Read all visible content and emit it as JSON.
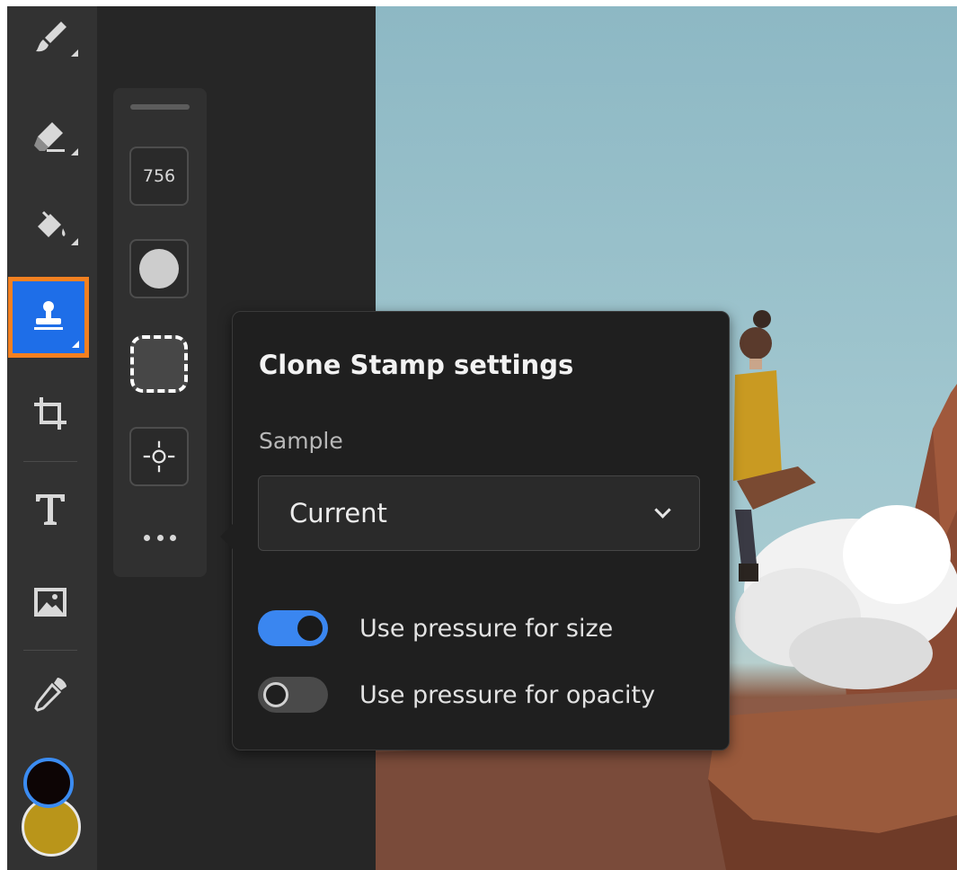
{
  "toolbar": {
    "tools": [
      {
        "name": "brush-tool",
        "icon": "brush-icon",
        "has_submenu": true
      },
      {
        "name": "eraser-tool",
        "icon": "eraser-icon",
        "has_submenu": true
      },
      {
        "name": "paint-bucket-tool",
        "icon": "paint-bucket-icon",
        "has_submenu": true
      },
      {
        "name": "clone-stamp-tool",
        "icon": "clone-stamp-icon",
        "has_submenu": true,
        "active": true
      },
      {
        "name": "crop-tool",
        "icon": "crop-icon"
      },
      {
        "name": "type-tool",
        "icon": "type-icon"
      },
      {
        "name": "place-image-tool",
        "icon": "image-icon"
      },
      {
        "name": "eyedropper-tool",
        "icon": "eyedropper-icon"
      }
    ],
    "foreground_color": "#0d0505",
    "background_color": "#b9951a",
    "active_color": "#1e6ee8",
    "highlight_color": "#f48020"
  },
  "options": {
    "size_value": "756",
    "soft_brush_icon": "soft-brush-icon",
    "hard_brush_icon": "hard-brush-icon",
    "sample_source_icon": "crosshair-icon",
    "more_icon": "more-icon"
  },
  "popover": {
    "title": "Clone Stamp settings",
    "sample_label": "Sample",
    "sample_value": "Current",
    "toggles": [
      {
        "label": "Use pressure for size",
        "on": true
      },
      {
        "label": "Use pressure for opacity",
        "on": false
      }
    ],
    "toggle_on_color": "#3a86f0"
  }
}
